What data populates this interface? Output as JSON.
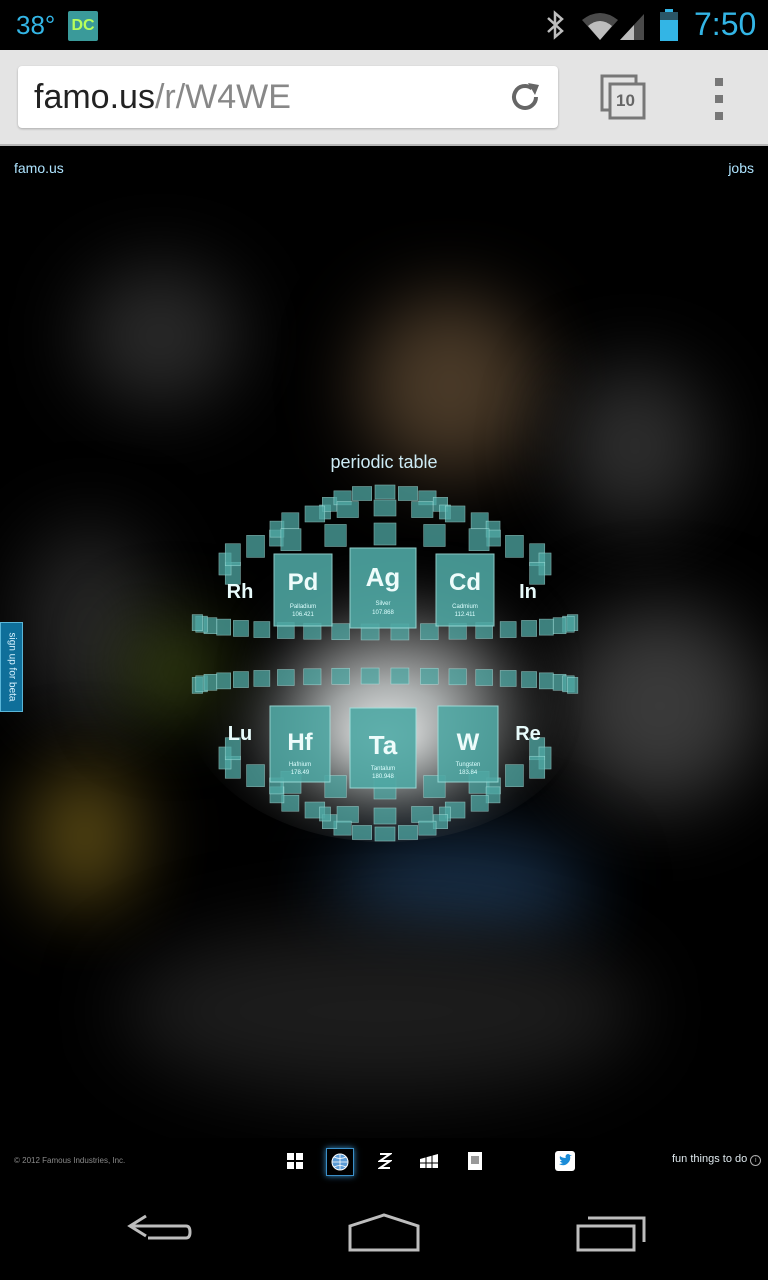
{
  "status_bar": {
    "temperature": "38°",
    "app_badge": "DC",
    "time": "7:50",
    "icons": [
      "bluetooth-icon",
      "wifi-icon",
      "signal-icon",
      "battery-icon"
    ]
  },
  "browser": {
    "url_domain": "famo.us",
    "url_path": "/r/W4WE",
    "tab_count": "10",
    "icons": [
      "reload-icon",
      "tabs-icon",
      "menu-icon"
    ]
  },
  "page": {
    "logo": "famo.us",
    "jobs_link": "jobs",
    "sphere_title": "periodic table",
    "beta_tab": "sign up for beta",
    "featured_elements": [
      {
        "symbol": "Pd",
        "name": "Palladium",
        "mass": "106.421"
      },
      {
        "symbol": "Ag",
        "name": "Silver",
        "mass": "107.868"
      },
      {
        "symbol": "Cd",
        "name": "Cadmium",
        "mass": "112.411"
      },
      {
        "symbol": "Hf",
        "name": "Hafnium",
        "mass": "178.49"
      },
      {
        "symbol": "Ta",
        "name": "Tantalum",
        "mass": "180.948"
      },
      {
        "symbol": "W",
        "name": "Tungsten",
        "mass": "183.84"
      }
    ],
    "side_elements": [
      "Rh",
      "In",
      "Lu",
      "Re"
    ],
    "accent_color": "#4fa8a4"
  },
  "footer": {
    "copyright": "© 2012 Famous Industries, Inc.",
    "fun_link": "fun things to do",
    "icons": [
      "windows-icon",
      "globe-icon",
      "zigzag-icon",
      "grid-icon",
      "card-icon",
      "twitter-icon",
      "info-icon"
    ]
  },
  "nav_bar": {
    "icons": [
      "back-icon",
      "home-icon",
      "recent-apps-icon"
    ]
  }
}
